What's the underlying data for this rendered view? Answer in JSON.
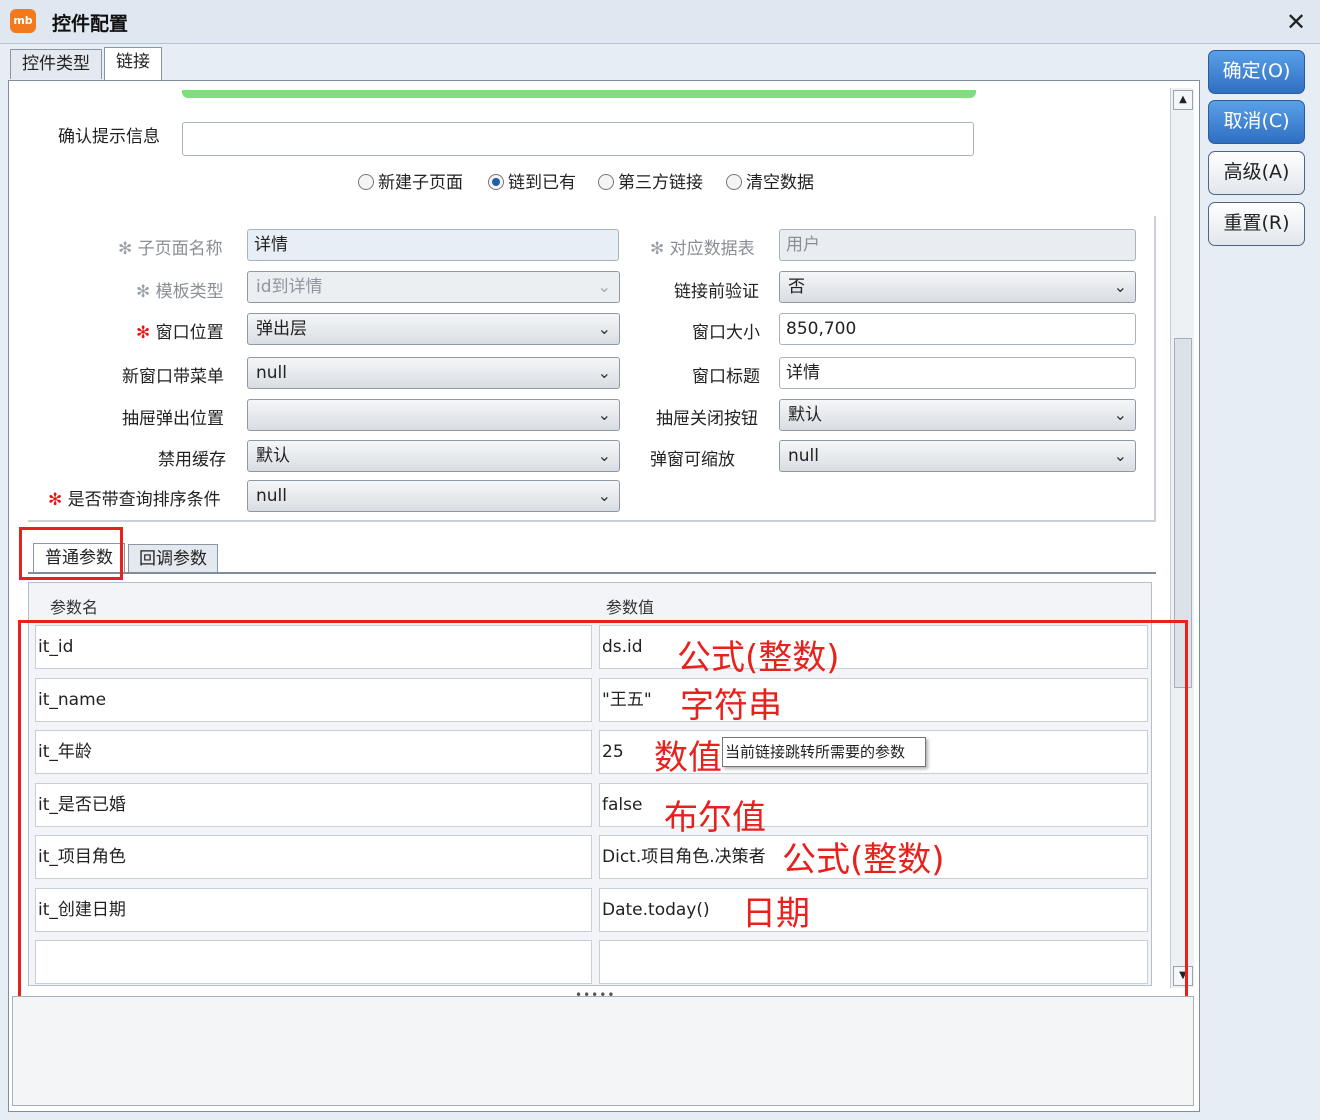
{
  "window": {
    "title": "控件配置",
    "close_glyph": "✕",
    "app_icon_text": "mb"
  },
  "top_tabs": [
    {
      "label": "控件类型"
    },
    {
      "label": "链接"
    }
  ],
  "confirm_info": {
    "label": "确认提示信息",
    "value": ""
  },
  "radios": [
    {
      "label": "新建子页面",
      "checked": false
    },
    {
      "label": "链到已有",
      "checked": true
    },
    {
      "label": "第三方链接",
      "checked": false
    },
    {
      "label": "清空数据",
      "checked": false
    }
  ],
  "form": {
    "subpage_name": {
      "label": "子页面名称",
      "value": "详情"
    },
    "data_table": {
      "label": "对应数据表",
      "value": "用户"
    },
    "template_type": {
      "label": "模板类型",
      "value": "id到详情"
    },
    "pre_verify": {
      "label": "链接前验证",
      "value": "否"
    },
    "window_position": {
      "label": "窗口位置",
      "value": "弹出层"
    },
    "window_size": {
      "label": "窗口大小",
      "value": "850,700"
    },
    "new_window_menu": {
      "label": "新窗口带菜单",
      "value": "null"
    },
    "window_title": {
      "label": "窗口标题",
      "value": "详情"
    },
    "drawer_position": {
      "label": "抽屉弹出位置",
      "value": ""
    },
    "drawer_close": {
      "label": "抽屉关闭按钮",
      "value": "默认"
    },
    "disable_cache": {
      "label": "禁用缓存",
      "value": "默认"
    },
    "popup_resizable": {
      "label": "弹窗可缩放",
      "value": "null"
    },
    "query_sort": {
      "label": "是否带查询排序条件",
      "value": "null"
    }
  },
  "required_mark": "✻",
  "param_tabs": [
    {
      "label": "普通参数"
    },
    {
      "label": "回调参数"
    }
  ],
  "grid": {
    "headers": [
      "参数名",
      "参数值"
    ],
    "rows": [
      {
        "name": "it_id",
        "value": "ds.id"
      },
      {
        "name": "it_name",
        "value": "\"王五\""
      },
      {
        "name": "it_年龄",
        "value": "25"
      },
      {
        "name": "it_是否已婚",
        "value": "false"
      },
      {
        "name": "it_项目角色",
        "value": "Dict.项目角色.决策者"
      },
      {
        "name": "it_创建日期",
        "value": "Date.today()"
      },
      {
        "name": "",
        "value": ""
      }
    ]
  },
  "tooltip": "当前链接跳转所需要的参数",
  "annotations": [
    "公式(整数)",
    "字符串",
    "数值",
    "布尔值",
    "公式(整数)",
    "日期"
  ],
  "buttons": [
    {
      "label": "确定(O)"
    },
    {
      "label": "取消(C)"
    },
    {
      "label": "高级(A)"
    },
    {
      "label": "重置(R)"
    }
  ],
  "splitter": "•••••",
  "colors": {
    "accent_red": "#e8211c",
    "primary_blue": "#2f6fc2",
    "progress_green": "#7ee07a"
  }
}
